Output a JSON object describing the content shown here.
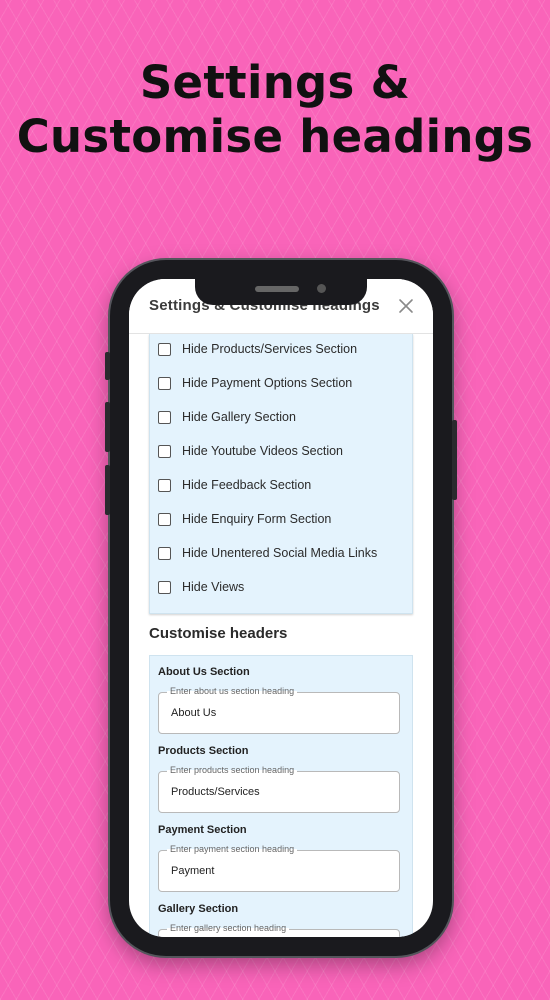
{
  "promo": {
    "title_line1": "Settings &",
    "title_line2": "Customise headings"
  },
  "dialog": {
    "title": "Settings & Customise headings",
    "close_icon": "close-icon"
  },
  "options": [
    {
      "label": "Hide Products/Services Section",
      "checked": false
    },
    {
      "label": "Hide Payment Options Section",
      "checked": false
    },
    {
      "label": "Hide Gallery Section",
      "checked": false
    },
    {
      "label": "Hide Youtube Videos Section",
      "checked": false
    },
    {
      "label": "Hide Feedback Section",
      "checked": false
    },
    {
      "label": "Hide Enquiry Form Section",
      "checked": false
    },
    {
      "label": "Hide Unentered Social Media Links",
      "checked": false
    },
    {
      "label": "Hide Views",
      "checked": false
    }
  ],
  "customise": {
    "heading": "Customise headers",
    "fields": [
      {
        "label": "About Us Section",
        "placeholder": "Enter about us section heading",
        "value": "About Us"
      },
      {
        "label": "Products Section",
        "placeholder": "Enter products section heading",
        "value": "Products/Services"
      },
      {
        "label": "Payment Section",
        "placeholder": "Enter payment section heading",
        "value": "Payment"
      },
      {
        "label": "Gallery Section",
        "placeholder": "Enter gallery section heading",
        "value": ""
      }
    ]
  },
  "colors": {
    "background": "#f964b9",
    "panel": "#e4f3fd",
    "phone_frame": "#1a1a1e"
  }
}
